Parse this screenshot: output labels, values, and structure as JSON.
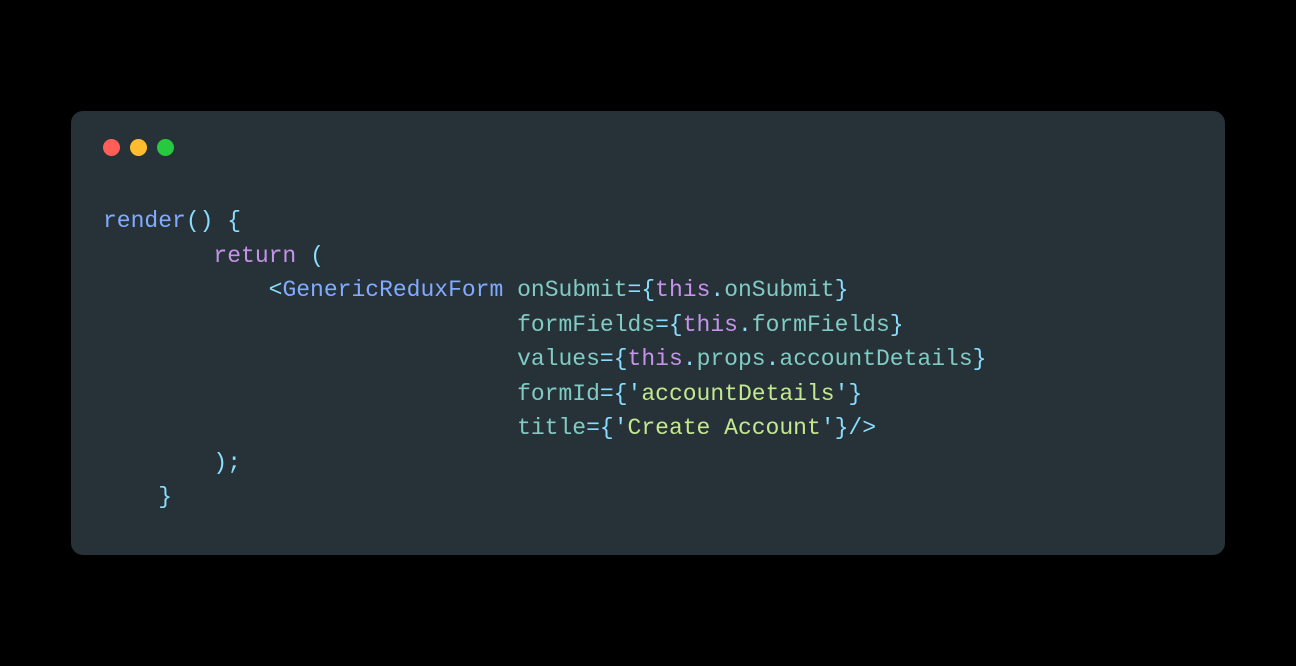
{
  "window": {
    "traffic_lights": {
      "close_color": "#ff5f56",
      "minimize_color": "#ffbd2e",
      "maximize_color": "#27c93f"
    }
  },
  "code": {
    "line1": {
      "render": "render",
      "parens": "()",
      "space": " ",
      "brace": "{"
    },
    "line2": {
      "indent": "        ",
      "return": "return",
      "space": " ",
      "paren": "("
    },
    "line3": {
      "indent": "            ",
      "lt": "<",
      "component": "GenericReduxForm",
      "space": " ",
      "attr": "onSubmit",
      "eq": "=",
      "lbrace": "{",
      "this": "this",
      "dot": ".",
      "prop": "onSubmit",
      "rbrace": "}"
    },
    "line4": {
      "indent": "                              ",
      "attr": "formFields",
      "eq": "=",
      "lbrace": "{",
      "this": "this",
      "dot": ".",
      "prop": "formFields",
      "rbrace": "}"
    },
    "line5": {
      "indent": "                              ",
      "attr": "values",
      "eq": "=",
      "lbrace": "{",
      "this": "this",
      "dot1": ".",
      "props": "props",
      "dot2": ".",
      "prop": "accountDetails",
      "rbrace": "}"
    },
    "line6": {
      "indent": "                              ",
      "attr": "formId",
      "eq": "=",
      "lbrace": "{",
      "q1": "'",
      "str": "accountDetails",
      "q2": "'",
      "rbrace": "}"
    },
    "line7": {
      "indent": "                              ",
      "attr": "title",
      "eq": "=",
      "lbrace": "{",
      "q1": "'",
      "str": "Create Account",
      "q2": "'",
      "rbrace": "}",
      "close": "/>"
    },
    "line8": {
      "indent": "        ",
      "close": ");"
    },
    "line9": {
      "indent": "    ",
      "brace": "}"
    }
  }
}
